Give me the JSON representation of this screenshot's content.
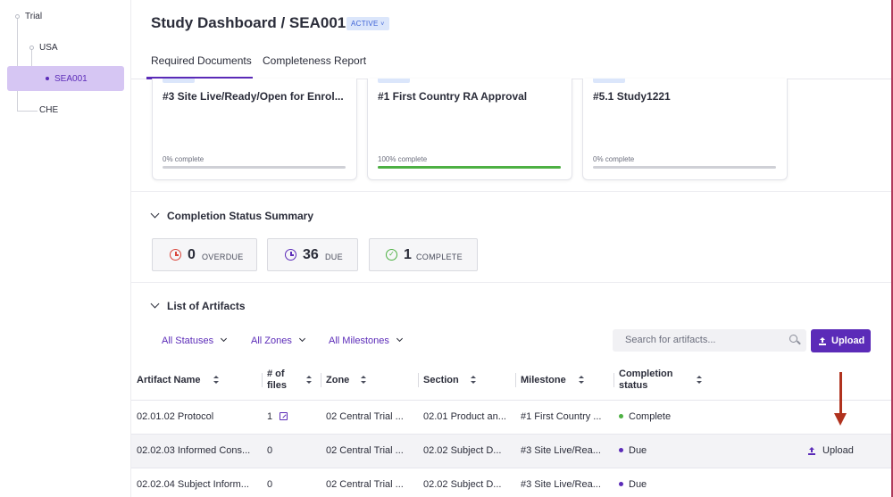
{
  "sidebar": {
    "tree": [
      {
        "label": "Trial"
      },
      {
        "label": "USA"
      },
      {
        "label": "SEA001",
        "selected": true
      },
      {
        "label": "CHE"
      }
    ]
  },
  "header": {
    "title": "Study Dashboard / SEA001",
    "status_badge": "ACTIVE",
    "tabs": [
      {
        "label": "Required Documents",
        "active": true
      },
      {
        "label": "Completeness Report",
        "active": false
      }
    ]
  },
  "milestone_cards": [
    {
      "title": "#3 Site Live/Ready/Open for Enrol...",
      "progress_label": "0% complete",
      "progress": 0
    },
    {
      "title": "#1 First Country RA Approval",
      "progress_label": "100% complete",
      "progress": 1
    },
    {
      "title": "#5.1 Study1221",
      "progress_label": "0% complete",
      "progress": 0
    }
  ],
  "summary": {
    "title": "Completion Status Summary",
    "stats": [
      {
        "value": "0",
        "label": "OVERDUE",
        "icon": "clock-icon",
        "color": "#d9453b"
      },
      {
        "value": "36",
        "label": "DUE",
        "icon": "clock-icon",
        "color": "#5b2bb8"
      },
      {
        "value": "1",
        "label": "COMPLETE",
        "icon": "check-circle-icon",
        "color": "#4db043"
      }
    ]
  },
  "artifacts": {
    "title": "List of Artifacts",
    "filters": [
      "All Statuses",
      "All Zones",
      "All Milestones"
    ],
    "search_placeholder": "Search for artifacts...",
    "upload_label": "Upload",
    "columns": [
      "Artifact Name",
      "# of files",
      "Zone",
      "Section",
      "Milestone",
      "Completion status"
    ],
    "rows": [
      {
        "name": "02.01.02 Protocol",
        "files": "1",
        "zone": "02 Central Trial ...",
        "section": "02.01 Product an...",
        "milestone": "#1 First Country ...",
        "status": "Complete",
        "status_color": "#4db043",
        "upload": ""
      },
      {
        "name": "02.02.03 Informed Cons...",
        "files": "0",
        "zone": "02 Central Trial ...",
        "section": "02.02 Subject D...",
        "milestone": "#3 Site Live/Rea...",
        "status": "Due",
        "status_color": "#5b2bb8",
        "upload": "Upload"
      },
      {
        "name": "02.02.04 Subject Inform...",
        "files": "0",
        "zone": "02 Central Trial ...",
        "section": "02.02 Subject D...",
        "milestone": "#3 Site Live/Rea...",
        "status": "Due",
        "status_color": "#5b2bb8",
        "upload": ""
      }
    ]
  },
  "colors": {
    "accent": "#5b2bb8",
    "complete": "#4db043",
    "overdue": "#d9453b",
    "annotation": "#b0321e"
  }
}
